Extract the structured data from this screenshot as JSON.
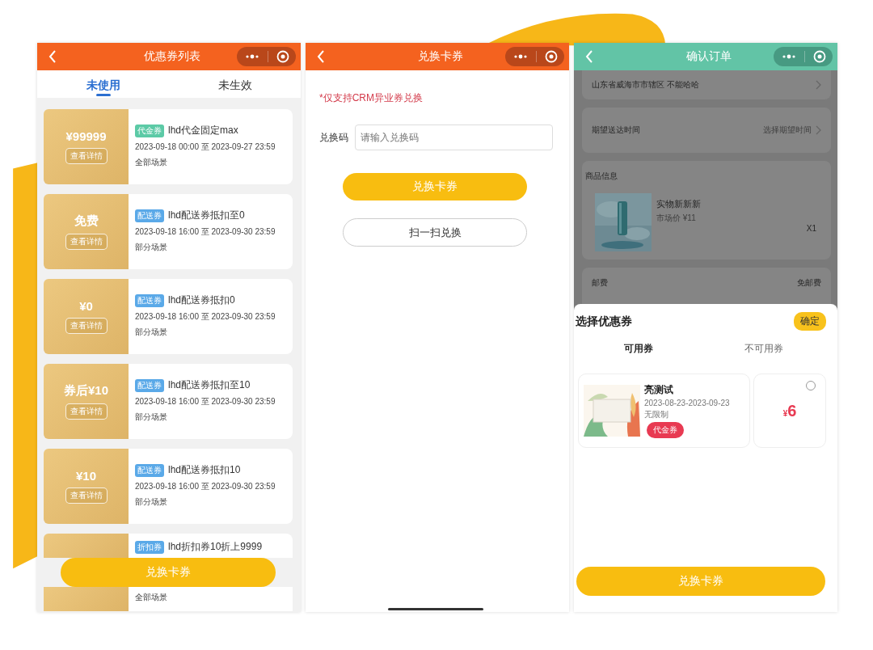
{
  "coupon_list": {
    "title": "优惠券列表",
    "tabs": [
      {
        "label": "未使用",
        "selected": true
      },
      {
        "label": "未生效",
        "selected": false
      }
    ],
    "coupons": [
      {
        "value": "¥99999",
        "details": "查看详情",
        "tag": "代金券",
        "color": "#5ccaa6",
        "title": "lhd代金固定max",
        "period": "2023-09-18 00:00 至 2023-09-27 23:59",
        "scene": "全部场景"
      },
      {
        "value": "免费",
        "details": "查看详情",
        "tag": "配送券",
        "color": "#5aa9e8",
        "title": "lhd配送券抵扣至0",
        "period": "2023-09-18 16:00 至 2023-09-30 23:59",
        "scene": "部分场景"
      },
      {
        "value": "¥0",
        "details": "查看详情",
        "tag": "配送券",
        "color": "#5aa9e8",
        "title": "lhd配送券抵扣0",
        "period": "2023-09-18 16:00 至 2023-09-30 23:59",
        "scene": "部分场景"
      },
      {
        "value": "券后¥10",
        "details": "查看详情",
        "tag": "配送券",
        "color": "#5aa9e8",
        "title": "lhd配送券抵扣至10",
        "period": "2023-09-18 16:00 至 2023-09-30 23:59",
        "scene": "部分场景"
      },
      {
        "value": "¥10",
        "details": "查看详情",
        "tag": "配送券",
        "color": "#5aa9e8",
        "title": "lhd配送券抵扣10",
        "period": "2023-09-18 16:00 至 2023-09-30 23:59",
        "scene": "部分场景"
      },
      {
        "tag": "折扣券",
        "color": "#5aa9e8",
        "title": "lhd折扣券10折上9999",
        "scene": "全部场景"
      }
    ],
    "button": "兑换卡券"
  },
  "redeem": {
    "title": "兑换卡券",
    "notice": "*仅支持CRM异业券兑换",
    "code_label": "兑换码",
    "code_placeholder": "请输入兑换码",
    "redeem_button": "兑换卡券",
    "scan_button": "扫一扫兑换"
  },
  "confirm_order": {
    "title": "确认订单",
    "address": "山东省威海市市辖区 不能哈哈",
    "delivery_label": "期望送达时间",
    "delivery_value": "选择期望时间",
    "goods_heading": "商品信息",
    "product": {
      "kind": "picture",
      "name": "实物新新新",
      "price": "市场价 ¥11",
      "quantity": "X1"
    },
    "postage_label": "邮费",
    "postage_value": "免邮费",
    "sheet": {
      "title": "选择优惠券",
      "confirm": "确定",
      "tabs": [
        {
          "label": "可用券",
          "selected": true
        },
        {
          "label": "不可用券",
          "selected": false
        }
      ],
      "coupons": [
        {
          "name": "亮测试",
          "period": "2023-08-23-2023-09-23",
          "limit": "无限制",
          "tag": "代金券",
          "currency": "¥",
          "amount": "6",
          "selected": false
        }
      ],
      "button": "兑换卡券"
    }
  }
}
